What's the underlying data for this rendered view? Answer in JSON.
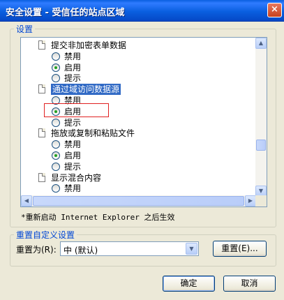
{
  "window": {
    "title": "安全设置 - 受信任的站点区域",
    "close_glyph": "×"
  },
  "settings_group": {
    "label": "设置",
    "items": [
      {
        "type": "category",
        "label": "提交非加密表单数据"
      },
      {
        "type": "option",
        "label": "禁用",
        "checked": false
      },
      {
        "type": "option",
        "label": "启用",
        "checked": true
      },
      {
        "type": "option",
        "label": "提示",
        "checked": false
      },
      {
        "type": "category",
        "label": "通过域访问数据源",
        "selected": true
      },
      {
        "type": "option",
        "label": "禁用",
        "checked": false
      },
      {
        "type": "option",
        "label": "启用",
        "checked": true,
        "highlighted": true
      },
      {
        "type": "option",
        "label": "提示",
        "checked": false
      },
      {
        "type": "category",
        "label": "拖放或复制和粘贴文件"
      },
      {
        "type": "option",
        "label": "禁用",
        "checked": false
      },
      {
        "type": "option",
        "label": "启用",
        "checked": true
      },
      {
        "type": "option",
        "label": "提示",
        "checked": false
      },
      {
        "type": "category",
        "label": "显示混合内容"
      },
      {
        "type": "option",
        "label": "禁用",
        "checked": false
      }
    ],
    "note": "*重新启动 Internet Explorer 之后生效"
  },
  "reset_group": {
    "label": "重置自定义设置",
    "reset_to_label": "重置为(R):",
    "level_value": "中 (默认)",
    "reset_button": "重置(E)..."
  },
  "buttons": {
    "ok": "确定",
    "cancel": "取消"
  }
}
